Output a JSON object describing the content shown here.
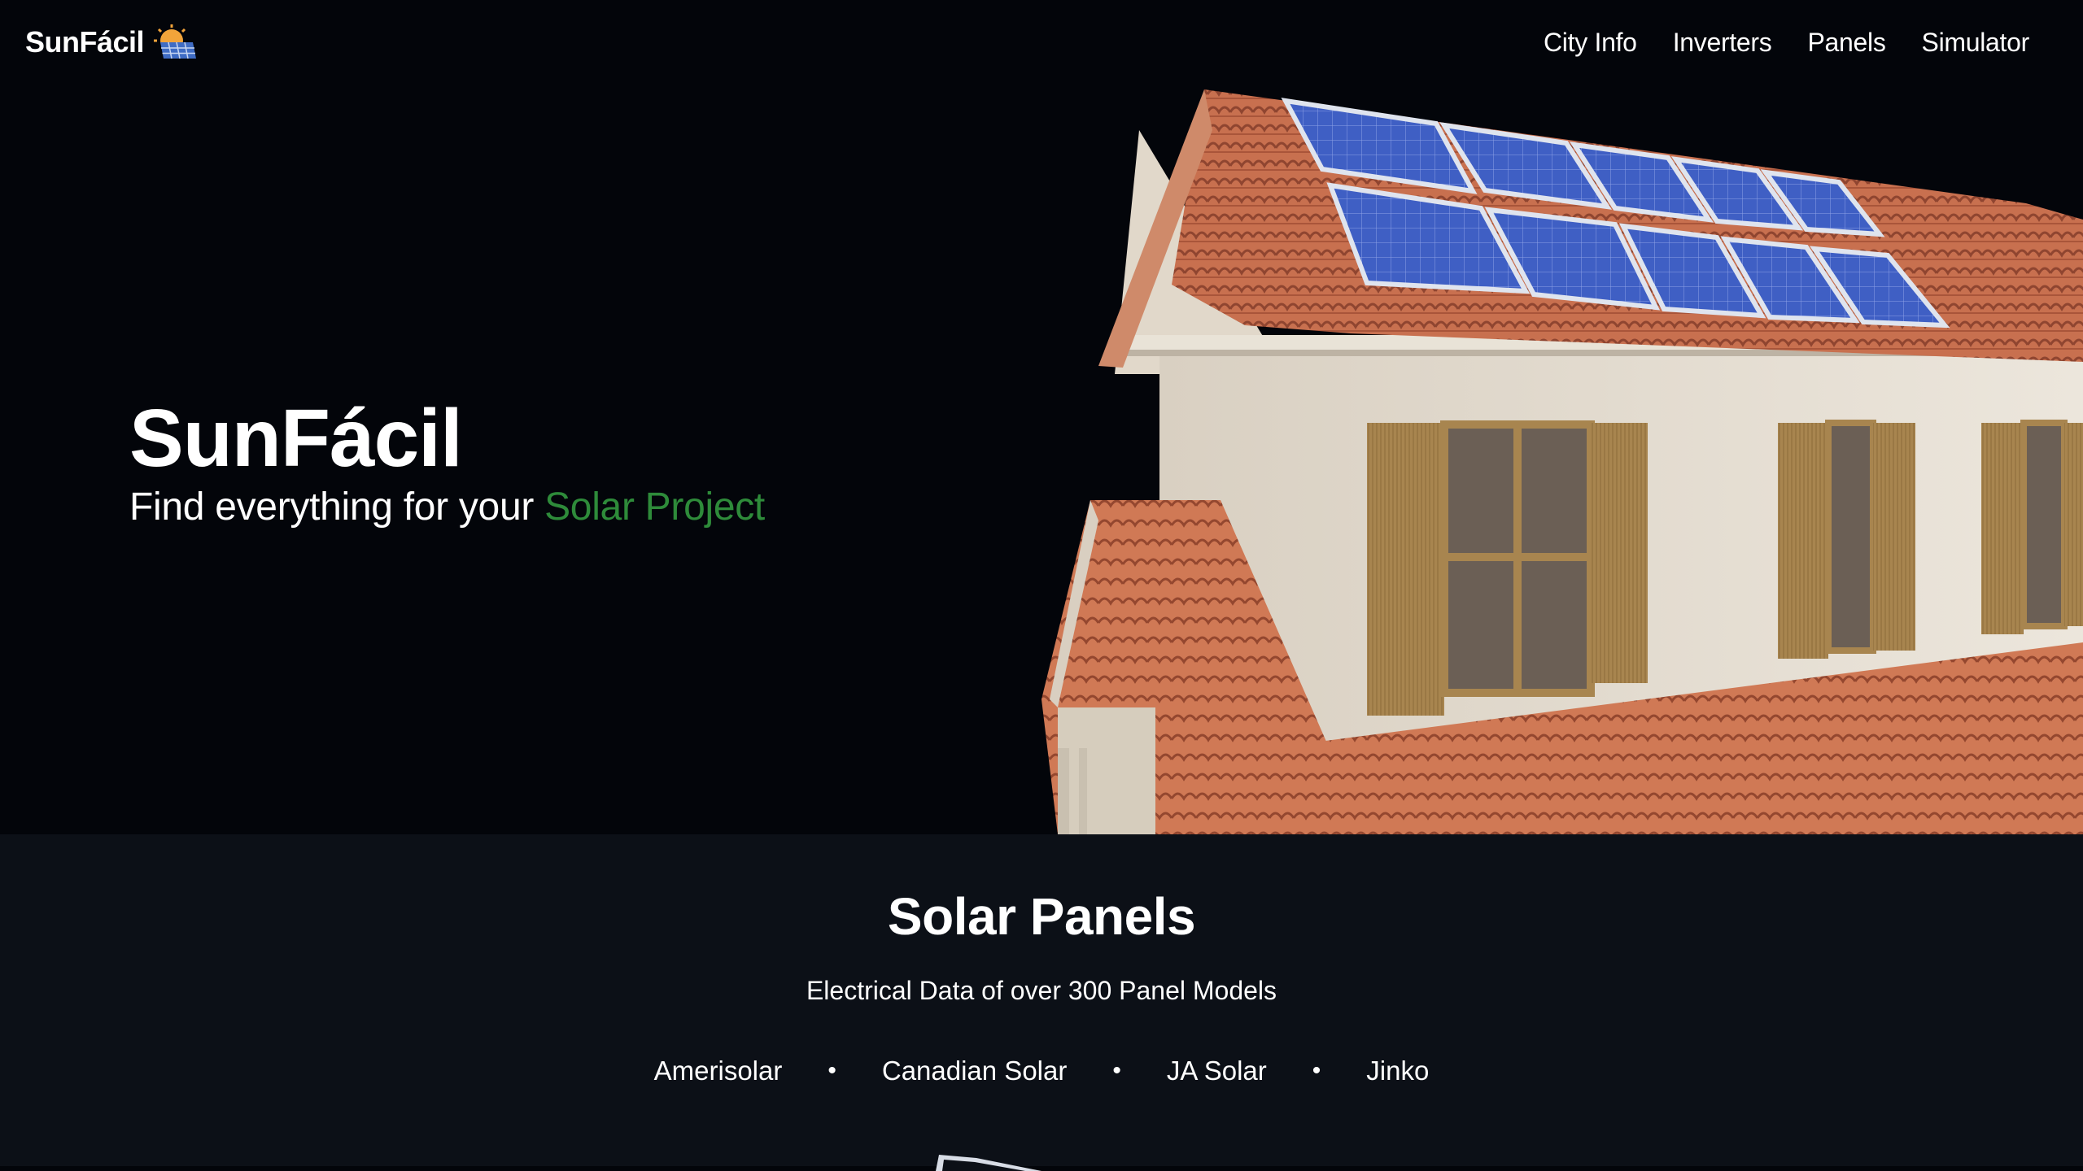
{
  "brand": {
    "name": "SunFácil",
    "logo_icon": "sun-panel-icon"
  },
  "nav": {
    "items": [
      {
        "label": "City Info"
      },
      {
        "label": "Inverters"
      },
      {
        "label": "Panels"
      },
      {
        "label": "Simulator"
      }
    ]
  },
  "hero": {
    "title": "SunFácil",
    "subtitle_prefix": "Find everything for your ",
    "subtitle_accent": "Solar Project",
    "accent_color": "#2e8b3a",
    "image": "house-with-solar-roof"
  },
  "panels_section": {
    "title": "Solar Panels",
    "subtitle": "Electrical Data of over 300 Panel Models",
    "brands": [
      "Amerisolar",
      "Canadian Solar",
      "JA Solar",
      "Jinko"
    ],
    "separator": "•"
  },
  "colors": {
    "hero_background": "#03050a",
    "section_background": "#0c1017",
    "accent": "#2e8b3a"
  }
}
